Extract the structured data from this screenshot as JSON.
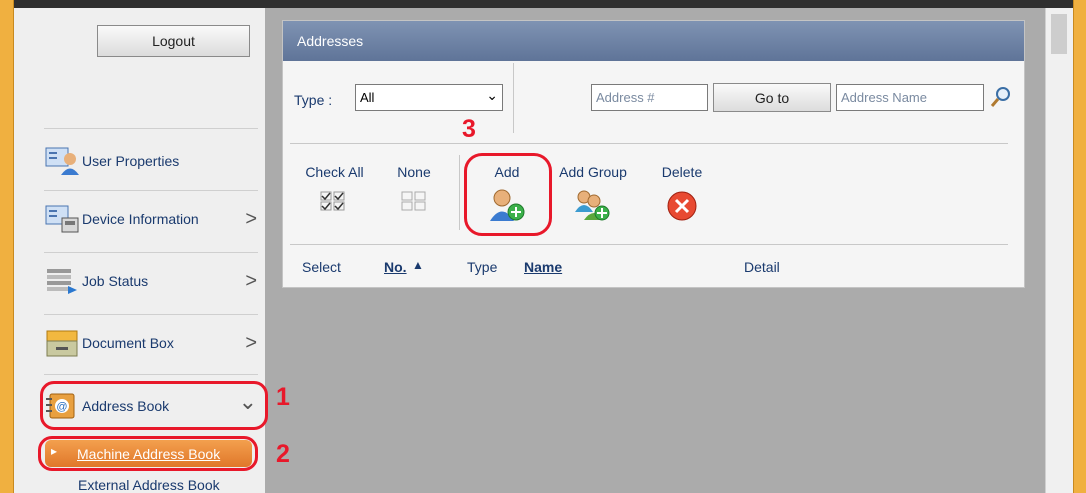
{
  "sidebar": {
    "logout_label": "Logout",
    "items": [
      {
        "label": "User Properties",
        "icon": "user-properties-icon",
        "chevron": ""
      },
      {
        "label": "Device Information",
        "icon": "device-information-icon",
        "chevron": ">"
      },
      {
        "label": "Job Status",
        "icon": "job-status-icon",
        "chevron": ">"
      },
      {
        "label": "Document Box",
        "icon": "document-box-icon",
        "chevron": ">"
      },
      {
        "label": "Address Book",
        "icon": "address-book-icon",
        "chevron": "⌄"
      }
    ],
    "submenu": {
      "machine_address_book": "Machine Address Book",
      "external_address_book": "External Address Book"
    }
  },
  "panel": {
    "title": "Addresses",
    "type_label": "Type :",
    "type_value": "All",
    "address_number_placeholder": "Address #",
    "goto_label": "Go to",
    "address_name_placeholder": "Address Name",
    "toolbar": {
      "check_all": "Check All",
      "none": "None",
      "add": "Add",
      "add_group": "Add Group",
      "delete": "Delete"
    },
    "columns": {
      "select": "Select",
      "no": "No.",
      "sort_indicator": "▲",
      "type": "Type",
      "name": "Name",
      "detail": "Detail"
    }
  },
  "callouts": [
    "1",
    "2",
    "3"
  ],
  "colors": {
    "highlight": "#e8182a",
    "header": "#6b7fa3",
    "frame": "#f0b040",
    "link": "#1a3a6e"
  }
}
